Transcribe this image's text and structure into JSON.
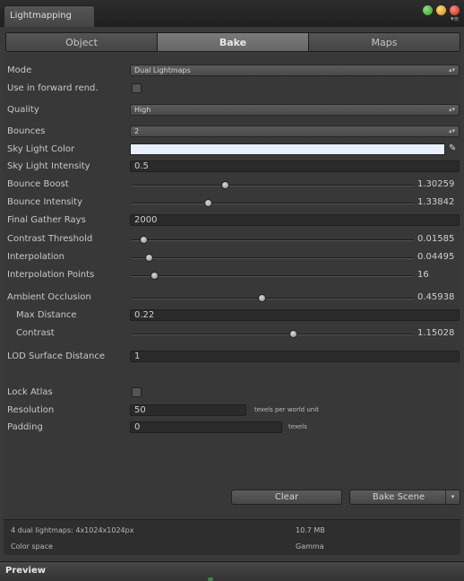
{
  "window": {
    "tab_title": "Lightmapping",
    "menu_glyph": "▾≡"
  },
  "tabs": [
    {
      "label": "Object",
      "active": false
    },
    {
      "label": "Bake",
      "active": true
    },
    {
      "label": "Maps",
      "active": false
    }
  ],
  "settings": {
    "mode": {
      "label": "Mode",
      "value": "Dual Lightmaps"
    },
    "forward": {
      "label": "Use in forward rend.",
      "checked": false
    },
    "quality": {
      "label": "Quality",
      "value": "High"
    },
    "bounces": {
      "label": "Bounces",
      "value": "2"
    },
    "sky_light_color": {
      "label": "Sky Light Color",
      "color": "#e8f0ff"
    },
    "sky_light_intensity": {
      "label": "Sky Light Intensity",
      "value": "0.5"
    },
    "bounce_boost": {
      "label": "Bounce Boost",
      "value": "1.30259",
      "fraction": 0.33
    },
    "bounce_intensity": {
      "label": "Bounce Intensity",
      "value": "1.33842",
      "fraction": 0.27
    },
    "final_gather_rays": {
      "label": "Final Gather Rays",
      "value": "2000"
    },
    "contrast_threshold": {
      "label": "Contrast Threshold",
      "value": "0.01585",
      "fraction": 0.04
    },
    "interpolation": {
      "label": "Interpolation",
      "value": "0.04495",
      "fraction": 0.06
    },
    "interpolation_points": {
      "label": "Interpolation Points",
      "value": "16",
      "fraction": 0.08
    },
    "ambient_occlusion": {
      "label": "Ambient Occlusion",
      "value": "0.45938",
      "fraction": 0.46
    },
    "max_distance": {
      "label": "Max Distance",
      "value": "0.22"
    },
    "contrast": {
      "label": "Contrast",
      "value": "1.15028",
      "fraction": 0.57
    },
    "lod_surface_distance": {
      "label": "LOD Surface Distance",
      "value": "1"
    },
    "lock_atlas": {
      "label": "Lock Atlas",
      "checked": false
    },
    "resolution": {
      "label": "Resolution",
      "value": "50",
      "unit": "texels per world unit"
    },
    "padding": {
      "label": "Padding",
      "value": "0",
      "unit": "texels"
    }
  },
  "buttons": {
    "clear": "Clear",
    "bake_scene": "Bake Scene",
    "bake_arrow": "▾"
  },
  "info": {
    "lightmaps": "4 dual lightmaps: 4x1024x1024px",
    "size": "10.7 MB",
    "color_space_label": "Color space",
    "color_space_value": "Gamma"
  },
  "preview": {
    "label": "Preview"
  },
  "arrows": {
    "dropdown": "▴▾"
  },
  "icons": {
    "eyedropper": "✎"
  }
}
